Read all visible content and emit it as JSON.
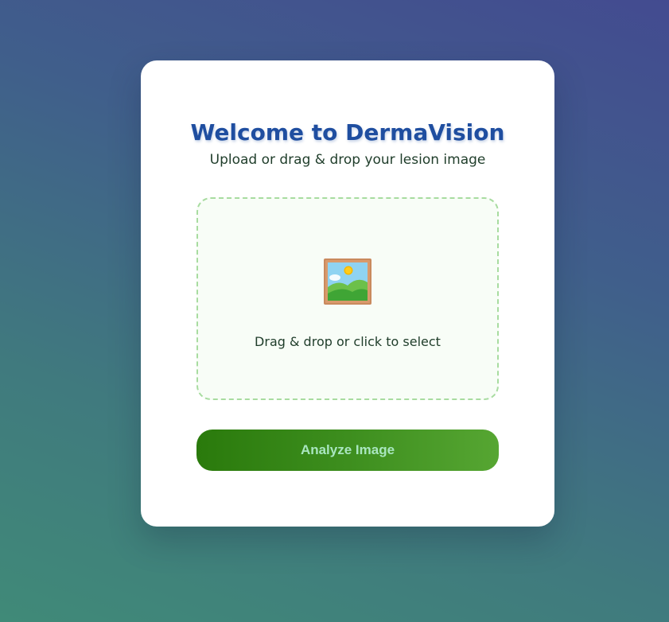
{
  "card": {
    "title": "Welcome to DermaVision",
    "subtitle": "Upload or drag & drop your lesion image"
  },
  "dropzone": {
    "icon": "framed-picture-icon",
    "text": "Drag & drop or click to select"
  },
  "actions": {
    "analyze_label": "Analyze Image"
  },
  "colors": {
    "title": "#1f4ea0",
    "accent_green": "#2a7a0c",
    "button_text": "#a9e6c0",
    "dropzone_border": "#a8dca0"
  }
}
